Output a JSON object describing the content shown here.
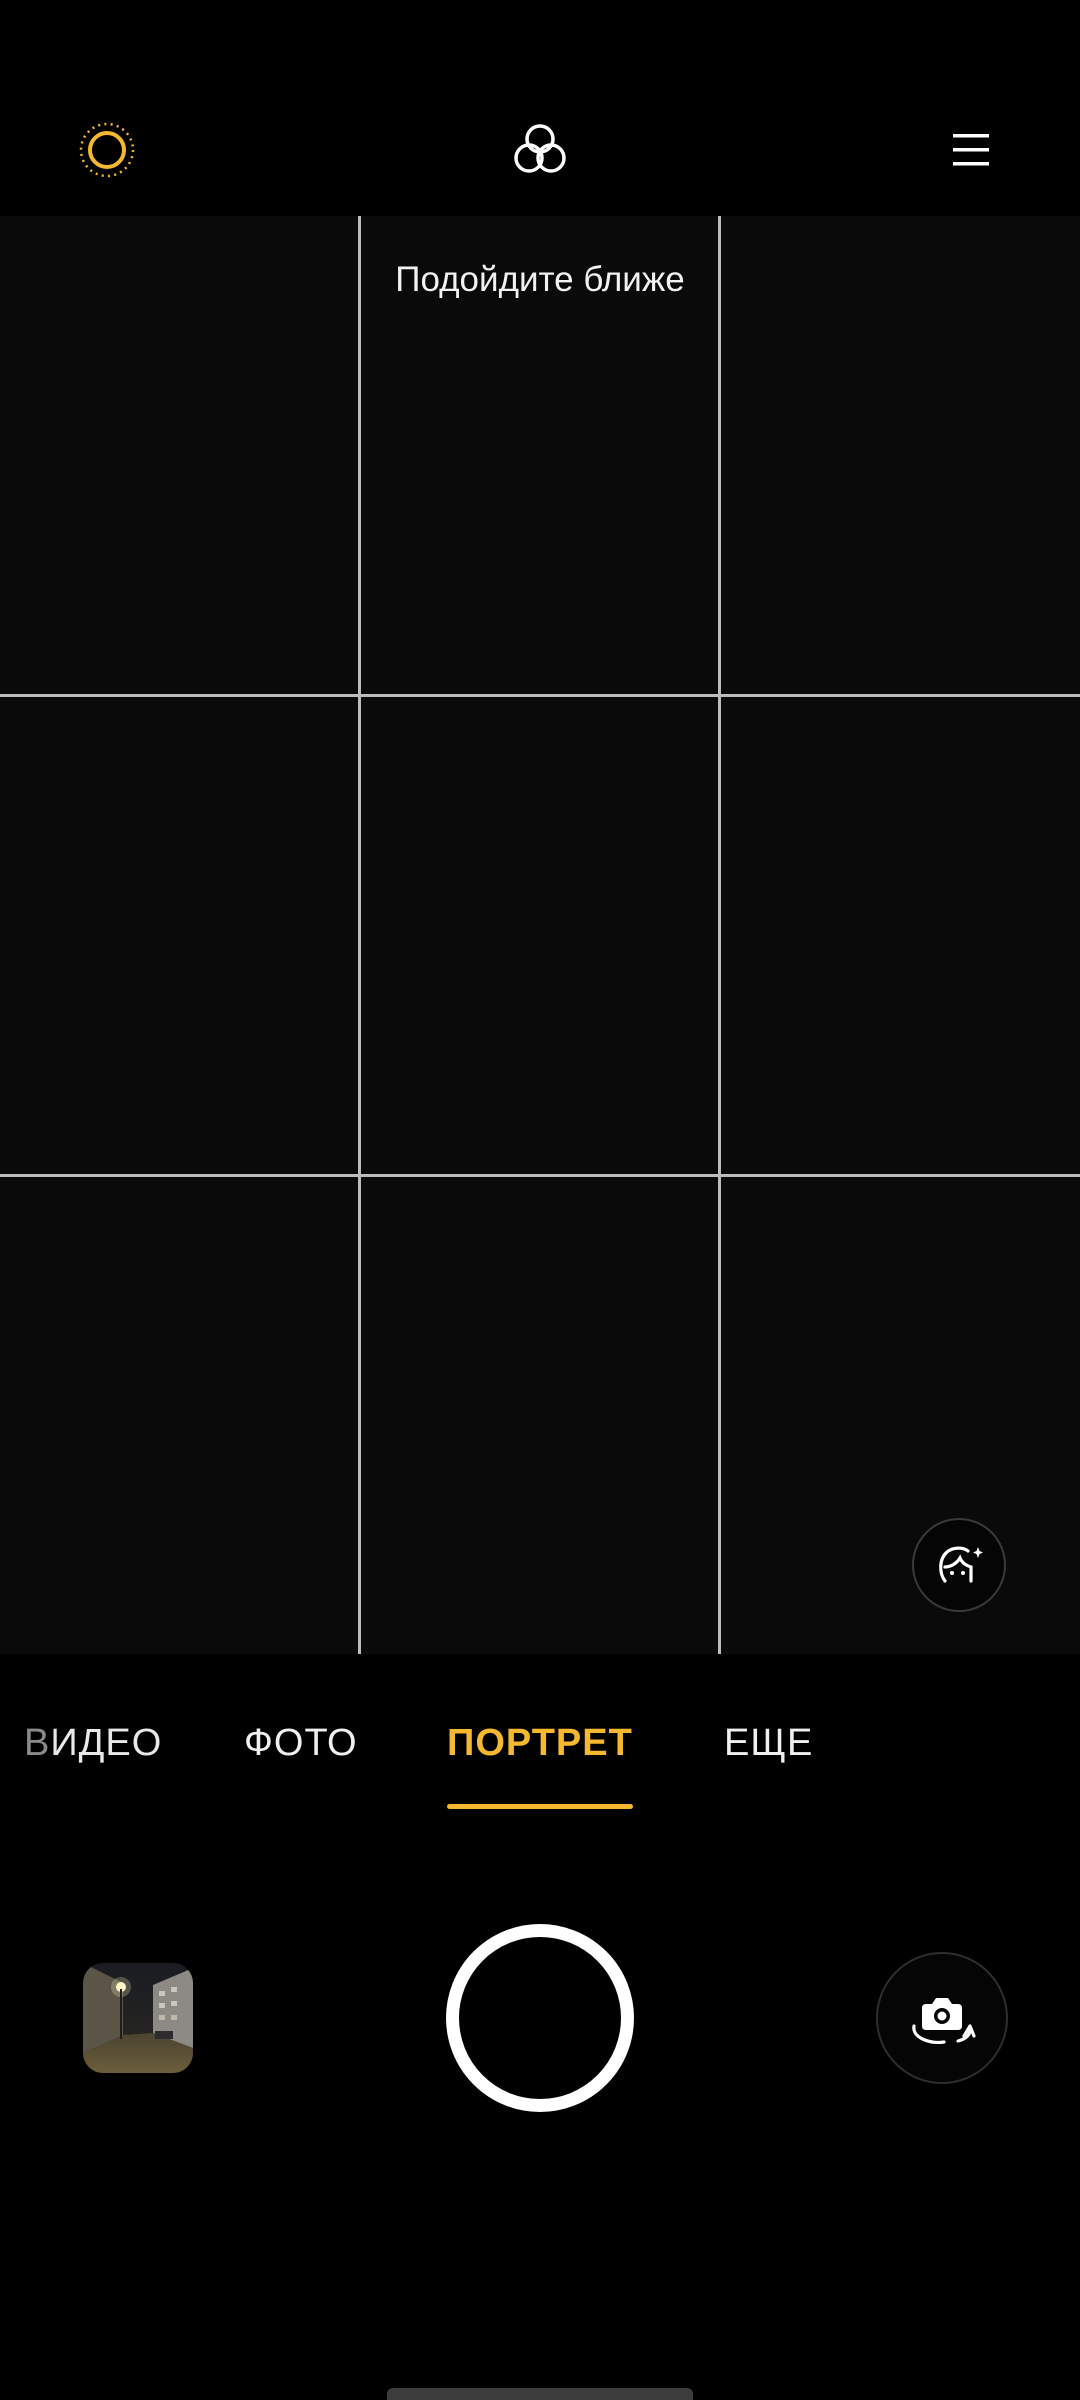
{
  "top_bar": {
    "icons": [
      "sun-icon",
      "filter-icon",
      "menu-icon"
    ]
  },
  "viewfinder": {
    "hint": "Подойдите ближе",
    "beauty_icon": "face-sparkle-icon"
  },
  "modes": {
    "video_prefix": "В",
    "video_rest": "ИДЕО",
    "photo": "ФОТО",
    "portrait": "ПОРТРЕТ",
    "more": "ЕЩЕ",
    "selected": "ПОРТРЕТ"
  },
  "controls": {
    "gallery_icon": "gallery-thumbnail",
    "shutter_icon": "shutter-button",
    "switch_icon": "camera-switch-icon"
  },
  "colors": {
    "accent": "#f5b82e",
    "background": "#000000",
    "grid": "#bdbdbd"
  }
}
